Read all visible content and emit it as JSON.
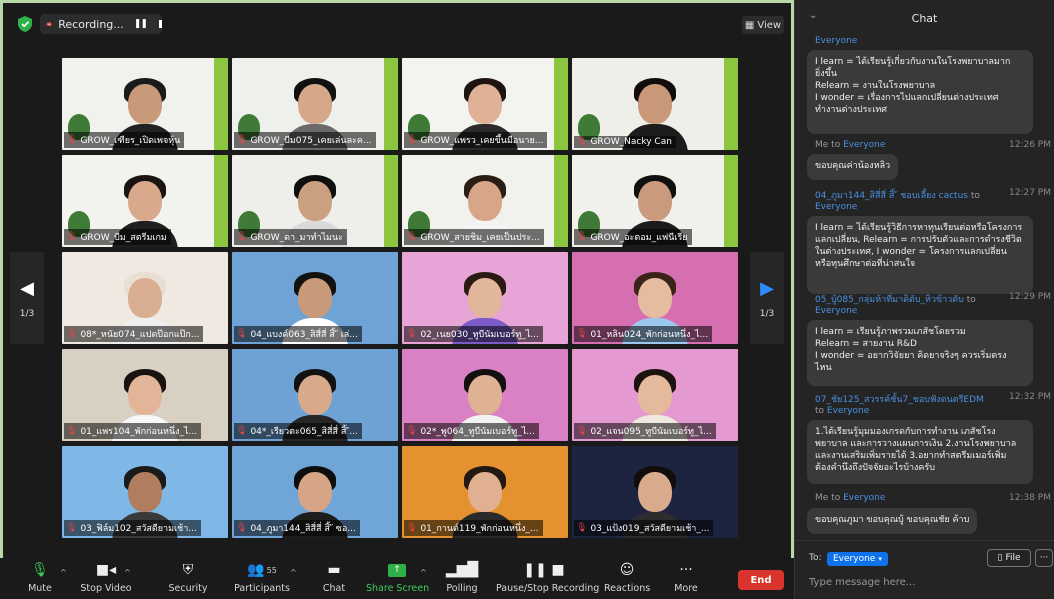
{
  "recording": {
    "label": "Recording..."
  },
  "view_button": {
    "label": "View"
  },
  "pager": {
    "left_page": "1/3",
    "right_page": "1/3"
  },
  "tiles": [
    {
      "name": "GROW_เฑียร_เปิดเพจหุ้น",
      "bg": "#f1f1ee",
      "skin": "#c89a7a",
      "hair": "#1a1a1a",
      "body": "#222222"
    },
    {
      "name": "GROW_บีม075_เคยเล่นละค...",
      "bg": "#eef0ec",
      "skin": "#d6a88a",
      "hair": "#111111",
      "body": "#6a6a6a"
    },
    {
      "name": "GROW_แพรว_เคยขึ้นมือนาย...",
      "bg": "#f3f3f0",
      "skin": "#dfb196",
      "hair": "#1d1410",
      "body": "#2b2b2b"
    },
    {
      "name": "GROW_Nacky Can",
      "bg": "#efefea",
      "skin": "#c99879",
      "hair": "#120c0a",
      "body": "#1c1c1c"
    },
    {
      "name": "GROW_บีม_สตรีมเกม",
      "bg": "#f2f2ee",
      "skin": "#d9a98c",
      "hair": "#1a1512",
      "body": "#1f1f1f"
    },
    {
      "name": "GROW_ดา_มาทำไมนะ",
      "bg": "#eeeeea",
      "skin": "#caa080",
      "hair": "#0f0f0f",
      "body": "#d9d9d9"
    },
    {
      "name": "GROW_สายชิม_เคยเป็นประ...",
      "bg": "#f1f1ed",
      "skin": "#d7a688",
      "hair": "#2a1d16",
      "body": "#f4f4f4"
    },
    {
      "name": "GROW_อะตอม_แฟนีเรีย",
      "bg": "#f0f0ec",
      "skin": "#c99b7c",
      "hair": "#101010",
      "body": "#1b1b1b"
    },
    {
      "name": "08*_หนัย074_แปดป๊อกแป๊ก...",
      "bg": "#efe9e1",
      "skin": "#d8ad90",
      "hair": "#e8ded3",
      "body": "#efefef"
    },
    {
      "name": "04_แบงค์063_สิสี่สี่ สิ้ ั เล่...",
      "bg": "#6fa3d6",
      "skin": "#c89a7a",
      "hair": "#111111",
      "body": "#ffffff"
    },
    {
      "name": "02_เนย030_ทูบีนัมเบอร์ทู_ไ...",
      "bg": "#e7a4d6",
      "skin": "#e2b69a",
      "hair": "#2c1b14",
      "body": "#7b5cc7"
    },
    {
      "name": "01_หลิน024_พักก่อนหนึ่ง_ไ...",
      "bg": "#d66fb0",
      "skin": "#e6bca0",
      "hair": "#3a2418",
      "body": "#9cc7ef"
    },
    {
      "name": "01_แพร104_พักก่อนหนึ่ง_ไ...",
      "bg": "#d9d0c4",
      "skin": "#e2b598",
      "hair": "#1a1210",
      "body": "#f7f7f7"
    },
    {
      "name": "04*_เรียวตะ065_สิสี่สี่ สิ้ ั...",
      "bg": "#6ea2d4",
      "skin": "#d8a98a",
      "hair": "#121212",
      "body": "#262626"
    },
    {
      "name": "02*_พู064_ทูบีนัมเบอร์ทู_ไ...",
      "bg": "#d981c4",
      "skin": "#dfb293",
      "hair": "#151010",
      "body": "#f2f2f2"
    },
    {
      "name": "02_แจน095_ทูบีนัมเบอร์ทู_ไ...",
      "bg": "#e49ad0",
      "skin": "#e4b99c",
      "hair": "#1c120e",
      "body": "#efe8de"
    },
    {
      "name": "03_ฟิล์ม102_สวัสดียามเช้า...",
      "bg": "#7fb8e6",
      "skin": "#b07e5e",
      "hair": "#1a1a1a",
      "body": "#3a3a3a"
    },
    {
      "name": "04_ภูมา144_สิสี่สี่ สิ้ ั ซอ...",
      "bg": "#70a5d8",
      "skin": "#d5a585",
      "hair": "#0e0e0e",
      "body": "#1d1d1d"
    },
    {
      "name": "01_กานต์119_พักก่อนหนึ่ง_...",
      "bg": "#e3922f",
      "skin": "#e0b090",
      "hair": "#241812",
      "body": "#2a2a2a"
    },
    {
      "name": "03_แป้ง019_สวัสดียามเช้า_...",
      "bg": "#1d2440",
      "skin": "#d8ab8c",
      "hair": "#120d0b",
      "body": "#2d2d2d"
    }
  ],
  "toolbar": {
    "mute": "Mute",
    "stop_video": "Stop Video",
    "security": "Security",
    "participants": "Participants",
    "participants_count": "55",
    "chat": "Chat",
    "share_screen": "Share Screen",
    "polling": "Polling",
    "pause_stop_recording": "Pause/Stop Recording",
    "reactions": "Reactions",
    "more": "More",
    "end": "End"
  },
  "chat": {
    "title": "Chat",
    "messages": [
      {
        "meta_from": "Everyone",
        "meta_muted": "",
        "meta_to": "",
        "time": "",
        "text": "I learn =  ได้เรียนรู้เกี่ยวกับงานในโรงพยาบาลมาก\nยิ่งขึ้น\nRelearn = งานในโรงพยาบาล\nI wonder = เรื่องการไปแลกเปลี่ยนต่างประเทศ\nทำงานต่างประเทศ"
      },
      {
        "meta_from": "",
        "meta_muted": "Me to ",
        "meta_to": "Everyone",
        "time": "12:26 PM",
        "text": "ขอบคุณค่าน้องหลิว"
      },
      {
        "meta_from": "04_ภูมา144_สิสี่สี่ สิ้ ั ชอบเลี้ยง cactus",
        "meta_muted": " to ",
        "meta_to": "Everyone",
        "time": "12:27 PM",
        "text": "I learn = ได้เรียนรู้วิธีการหาทุนเรียนต่อหรือโครงการ\nแลกเปลี่ยน, Relearn = การปรับตัวและการดำรงชีวิต\nในต่างประเทศ, I wonder = โครงการแลกเปลี่ยน\nหรือทุนศึกษาต่อที่น่าสนใจ"
      },
      {
        "meta_from": "05_บู้085_กลุ่มห้าที่มาดิดับ_หิวข้าวดับ",
        "meta_muted": " to ",
        "meta_to": "Everyone",
        "time": "12:29 PM",
        "text": "I learn = เรียนรู้ภาพรวมเภสัชโดยรวม\nRelearn = สายงาน R&D\nI wonder = อยากวิจัยยา คิดยาจริงๆ ควรเริ่มตรง\nไหน"
      },
      {
        "meta_from": "07_ชัย125_สวรรค์ชั้น7_ชอบฟังดนตรีEDM",
        "meta_muted": " to ",
        "meta_to": "Everyone",
        "time": "12:32 PM",
        "text": "1.ได้เรียนรู้มุมมองเกรดกับการทำงาน เภสัชโรง\nพยาบาล และการวางแผนการเงิน 2.งานโรงพยาบาล\nและงานเสริมเพิ่มรายได้ 3.อยากทำสตรีมเมอร์เพิ่ม\nต้องคำนึงถึงปัจจัยอะไรบ้างครับ"
      },
      {
        "meta_from": "",
        "meta_muted": "Me to ",
        "meta_to": "Everyone",
        "time": "12:38 PM",
        "text": "ขอบคุณภูมา ขอบคุณบู้ ขอบคุณชัย ค้าบ"
      }
    ],
    "to_label": "To:",
    "to_value": "Everyone",
    "file_label": "File",
    "more_label": "···",
    "input_placeholder": "Type message here..."
  }
}
